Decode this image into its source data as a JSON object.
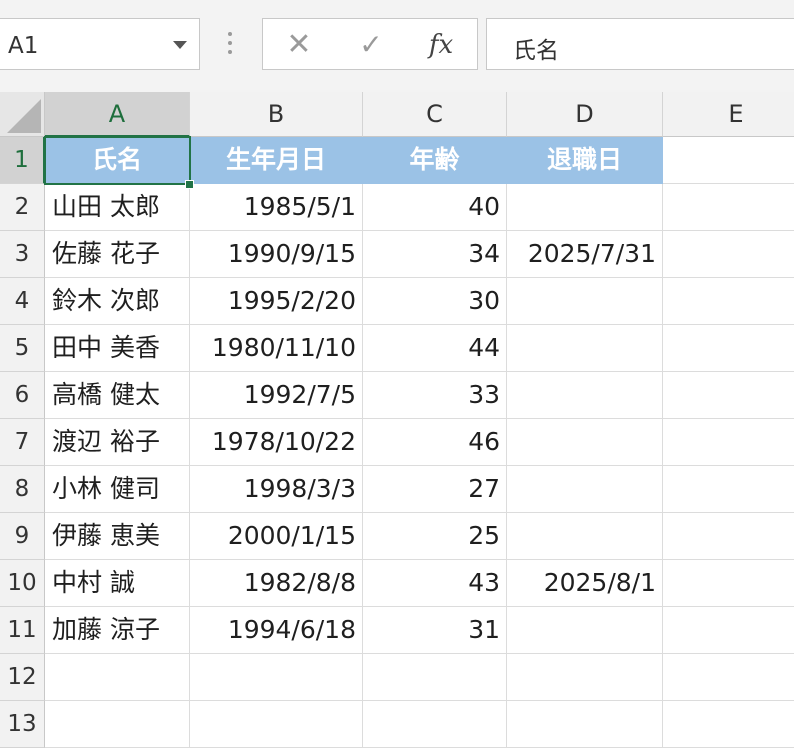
{
  "name_box": {
    "ref": "A1"
  },
  "formula_bar": {
    "fx_label": "fx",
    "content": "氏名",
    "cancel_glyph": "✕",
    "enter_glyph": "✓"
  },
  "columns": [
    "A",
    "B",
    "C",
    "D",
    "E"
  ],
  "row_numbers": [
    "1",
    "2",
    "3",
    "4",
    "5",
    "6",
    "7",
    "8",
    "9",
    "10",
    "11",
    "12",
    "13"
  ],
  "header_row": [
    "氏名",
    "生年月日",
    "年齢",
    "退職日"
  ],
  "rows": [
    [
      "山田 太郎",
      "1985/5/1",
      "40",
      ""
    ],
    [
      "佐藤 花子",
      "1990/9/15",
      "34",
      "2025/7/31"
    ],
    [
      "鈴木 次郎",
      "1995/2/20",
      "30",
      ""
    ],
    [
      "田中 美香",
      "1980/11/10",
      "44",
      ""
    ],
    [
      "高橋 健太",
      "1992/7/5",
      "33",
      ""
    ],
    [
      "渡辺 裕子",
      "1978/10/22",
      "46",
      ""
    ],
    [
      "小林 健司",
      "1998/3/3",
      "27",
      ""
    ],
    [
      "伊藤 恵美",
      "2000/1/15",
      "25",
      ""
    ],
    [
      "中村 誠",
      "1982/8/8",
      "43",
      "2025/8/1"
    ],
    [
      "加藤 涼子",
      "1994/6/18",
      "31",
      ""
    ]
  ],
  "colors": {
    "header_fill": "#9bc2e6",
    "selection": "#217346",
    "header_text": "#ffffff"
  }
}
